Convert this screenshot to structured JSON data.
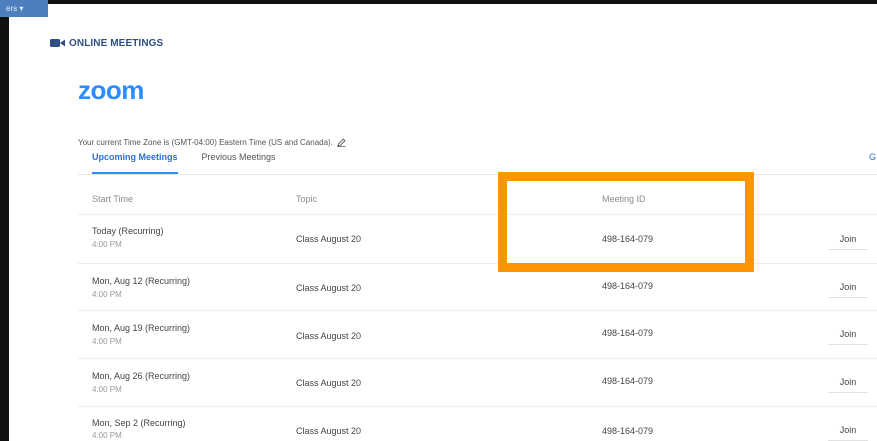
{
  "app": {
    "corner_tab_label": "ers ▾",
    "section_title": "ONLINE MEETINGS",
    "section_icon": "video-camera-icon",
    "logo_text": "zoom",
    "timezone_note": "Your current Time Zone is (GMT-04:00) Eastern Time (US and Canada).",
    "edit_icon": "pencil-icon"
  },
  "tabs": [
    {
      "label": "Upcoming Meetings",
      "active": true
    },
    {
      "label": "Previous Meetings",
      "active": false
    }
  ],
  "cut_off_link": "G",
  "table": {
    "columns": [
      "Start Time",
      "Topic",
      "Meeting ID"
    ],
    "rows": [
      {
        "date": "Today (Recurring)",
        "time": "4:00 PM",
        "topic": "Class August 20",
        "meeting_id": "498-164-079",
        "action": "Join"
      },
      {
        "date": "Mon, Aug 12 (Recurring)",
        "time": "4:00 PM",
        "topic": "Class August 20",
        "meeting_id": "498-164-079",
        "action": "Join"
      },
      {
        "date": "Mon, Aug 19 (Recurring)",
        "time": "4:00 PM",
        "topic": "Class August 20",
        "meeting_id": "498-164-079",
        "action": "Join"
      },
      {
        "date": "Mon, Aug 26 (Recurring)",
        "time": "4:00 PM",
        "topic": "Class August 20",
        "meeting_id": "498-164-079",
        "action": "Join"
      },
      {
        "date": "Mon, Sep 2 (Recurring)",
        "time": "4:00 PM",
        "topic": "Class August 20",
        "meeting_id": "498-164-079",
        "action": "Join"
      }
    ]
  },
  "colors": {
    "accent": "#2d8cff",
    "header_title": "#2d4f86",
    "highlight_box": "#ff9500"
  }
}
